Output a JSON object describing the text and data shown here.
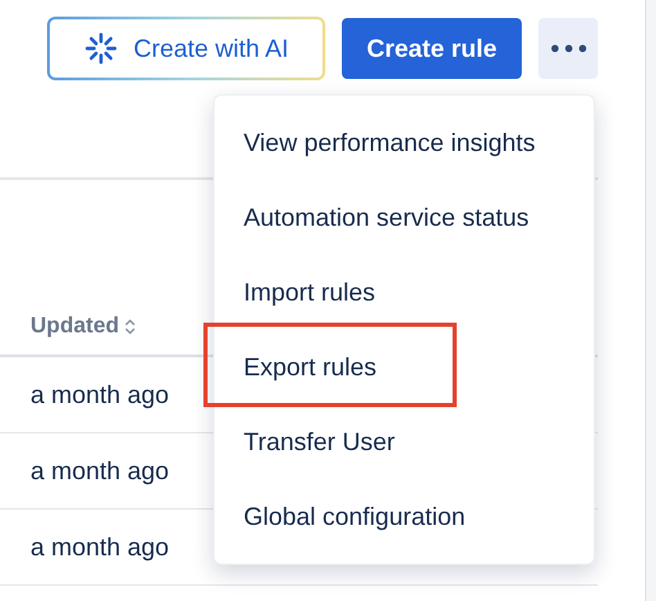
{
  "toolbar": {
    "ai_button": "Create with AI",
    "create_button": "Create rule"
  },
  "menu": {
    "expanded": true,
    "items": [
      {
        "label": "View performance insights",
        "highlighted": false
      },
      {
        "label": "Automation service status",
        "highlighted": false
      },
      {
        "label": "Import rules",
        "highlighted": false
      },
      {
        "label": "Export rules",
        "highlighted": true
      },
      {
        "label": "Transfer User",
        "highlighted": false
      },
      {
        "label": "Global configuration",
        "highlighted": false
      }
    ]
  },
  "table": {
    "columns": [
      {
        "label": "Updated",
        "sortable": true
      }
    ],
    "rows": [
      {
        "updated": "a month ago"
      },
      {
        "updated": "a month ago"
      },
      {
        "updated": "a month ago"
      }
    ]
  }
}
